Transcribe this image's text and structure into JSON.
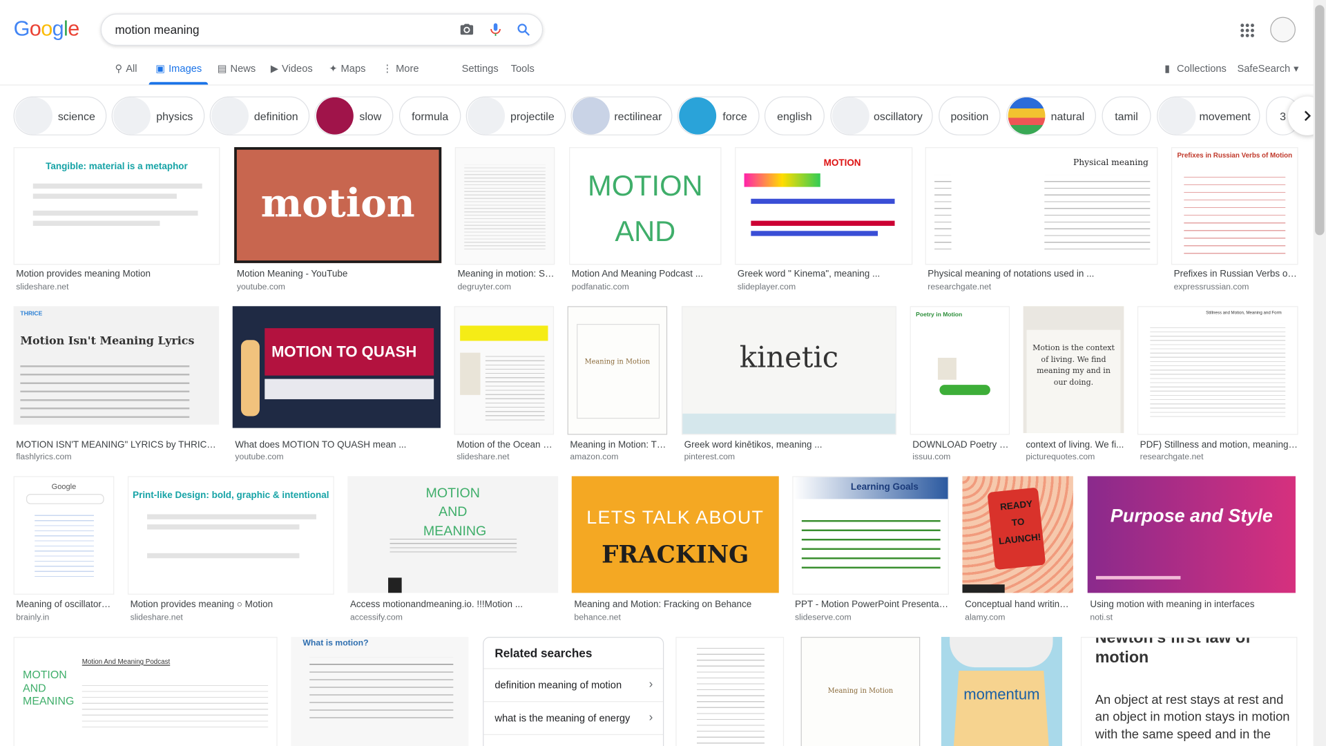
{
  "search": {
    "query": "motion meaning"
  },
  "nav": {
    "tabs": [
      {
        "label": "All"
      },
      {
        "label": "Images"
      },
      {
        "label": "News"
      },
      {
        "label": "Videos"
      },
      {
        "label": "Maps"
      },
      {
        "label": "More"
      }
    ],
    "settings": "Settings",
    "tools": "Tools",
    "collections": "Collections",
    "safesearch": "SafeSearch"
  },
  "chips": [
    "science",
    "physics",
    "definition",
    "slow",
    "formula",
    "projectile",
    "rectilinear",
    "force",
    "english",
    "oscillatory",
    "position",
    "natural",
    "tamil",
    "movement",
    "3"
  ],
  "results": [
    {
      "title": "Motion provides meaning Motion",
      "source": "slideshare.net",
      "text": "Tangible: material is a metaphor"
    },
    {
      "title": "Motion Meaning - YouTube",
      "source": "youtube.com",
      "text": "motion"
    },
    {
      "title": "Meaning in motion: Sh...",
      "source": "degruyter.com",
      "text": ""
    },
    {
      "title": "Motion And Meaning Podcast ...",
      "source": "podfanatic.com",
      "text": "MOTION AND MEANING"
    },
    {
      "title": "Greek word \" Kinema\", meaning ...",
      "source": "slideplayer.com",
      "text": "MOTION"
    },
    {
      "title": "Physical meaning of notations used in ...",
      "source": "researchgate.net",
      "text": "Physical meaning"
    },
    {
      "title": "Prefixes in Russian Verbs of ...",
      "source": "expressrussian.com",
      "text": "Prefixes in Russian Verbs of Motion"
    },
    {
      "title": "MOTION ISN'T MEANING\" LYRICS by THRICE ...",
      "source": "flashlyrics.com",
      "text": "Motion Isn't Meaning Lyrics"
    },
    {
      "title": "What does MOTION TO QUASH mean ...",
      "source": "youtube.com",
      "text": "MOTION TO QUASH"
    },
    {
      "title": "Motion of the Ocean 1...",
      "source": "slideshare.net",
      "text": ""
    },
    {
      "title": "Meaning in Motion: Th...",
      "source": "amazon.com",
      "text": "Meaning in Motion"
    },
    {
      "title": "Greek word kinētikos, meaning ...",
      "source": "pinterest.com",
      "text": "kinetic"
    },
    {
      "title": "DOWNLOAD Poetry in...",
      "source": "issuu.com",
      "text": "Poetry in Motion"
    },
    {
      "title": "context of living. We fi...",
      "source": "picturequotes.com",
      "text": "Motion is the context of living. We find meaning my and in our doing."
    },
    {
      "title": "PDF) Stillness and motion, meaning a...",
      "source": "researchgate.net",
      "text": "Stillness and Motion, Meaning and Form"
    },
    {
      "title": "Meaning of oscillatory ...",
      "source": "brainly.in",
      "text": "Google"
    },
    {
      "title": "Motion provides meaning ○ Motion",
      "source": "slideshare.net",
      "text": "Print-like Design: bold, graphic & intentional"
    },
    {
      "title": "Access motionandmeaning.io. !!!Motion ...",
      "source": "accessify.com",
      "text": "MOTION AND MEANING"
    },
    {
      "title": "Meaning and Motion: Fracking on Behance",
      "source": "behance.net",
      "text": "LETS TALK ABOUT"
    },
    {
      "title": "PPT - Motion PowerPoint Presentatio...",
      "source": "slideserve.com",
      "text": "Learning Goals"
    },
    {
      "title": "Conceptual hand writing ...",
      "source": "alamy.com",
      "text": "READY TO LAUNCH!"
    },
    {
      "title": "Using motion with meaning in interfaces",
      "source": "noti.st",
      "text": "Purpose and Style"
    }
  ],
  "bottom": {
    "podcast_title": "Motion And Meaning Podcast",
    "whatis": "What is motion?",
    "momentum": "momentum",
    "newton_title": "Newton's first law of motion",
    "newton_text": "An object at rest stays at rest and an object in motion stays in motion with the same speed and in the"
  },
  "related": {
    "heading": "Related searches",
    "items": [
      "definition meaning of motion",
      "what is the meaning of energy"
    ]
  },
  "colors": {
    "accent": "#1a73e8",
    "blue": "#4285F4",
    "red": "#EA4335",
    "yellow": "#FBBC05",
    "green": "#34A853"
  }
}
